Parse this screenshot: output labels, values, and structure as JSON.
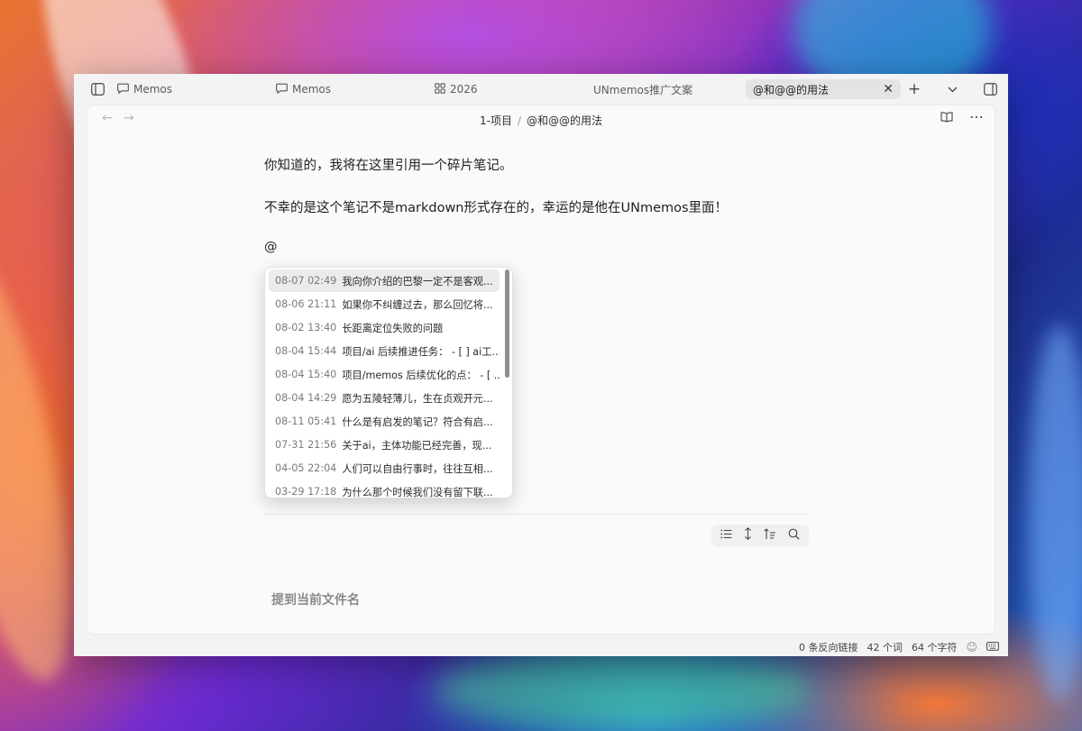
{
  "tabs": [
    {
      "label": "Memos",
      "icon": "speech-bubble-icon"
    },
    {
      "label": "Memos",
      "icon": "speech-bubble-icon"
    },
    {
      "label": "2026",
      "icon": "grid-icon"
    },
    {
      "label": "UNmemos推广文案"
    },
    {
      "label": "@和@@的用法",
      "active": true
    }
  ],
  "breadcrumb": {
    "folder": "1-项目",
    "separator": "/",
    "file": "@和@@的用法"
  },
  "editor": {
    "line1": "你知道的，我将在这里引用一个碎片笔记。",
    "line2": "不幸的是这个笔记不是markdown形式存在的，幸运的是他在UNmemos里面！",
    "line3": "@"
  },
  "suggestions": [
    {
      "date": "08-07 02:49",
      "text": "我向你介绍的巴黎一定不是客观..."
    },
    {
      "date": "08-06 21:11",
      "text": "如果你不纠缠过去，那么回忆将..."
    },
    {
      "date": "08-02 13:40",
      "text": "长距离定位失败的问题"
    },
    {
      "date": "08-04 15:44",
      "text": "项目/ai 后续推进任务： - [ ] ai工..."
    },
    {
      "date": "08-04 15:40",
      "text": "项目/memos 后续优化的点： - [ ..."
    },
    {
      "date": "08-04 14:29",
      "text": "愿为五陵轻薄儿，生在贞观开元..."
    },
    {
      "date": "08-11 05:41",
      "text": "什么是有启发的笔记？符合有启..."
    },
    {
      "date": "07-31 21:56",
      "text": "关于ai，主体功能已经完善，现..."
    },
    {
      "date": "04-05 22:04",
      "text": "人们可以自由行事时，往往互相..."
    },
    {
      "date": "03-29 17:18",
      "text": "为什么那个时候我们没有留下联..."
    }
  ],
  "backlinks": {
    "title": "提到当前文件名"
  },
  "status": {
    "backlinks": "0 条反向链接",
    "words": "42 个词",
    "chars": "64 个字符"
  },
  "colors": {
    "accent_selected_row": "#ebebeb",
    "window_bg": "#f3f3f4",
    "pane_bg": "#fafafa"
  }
}
